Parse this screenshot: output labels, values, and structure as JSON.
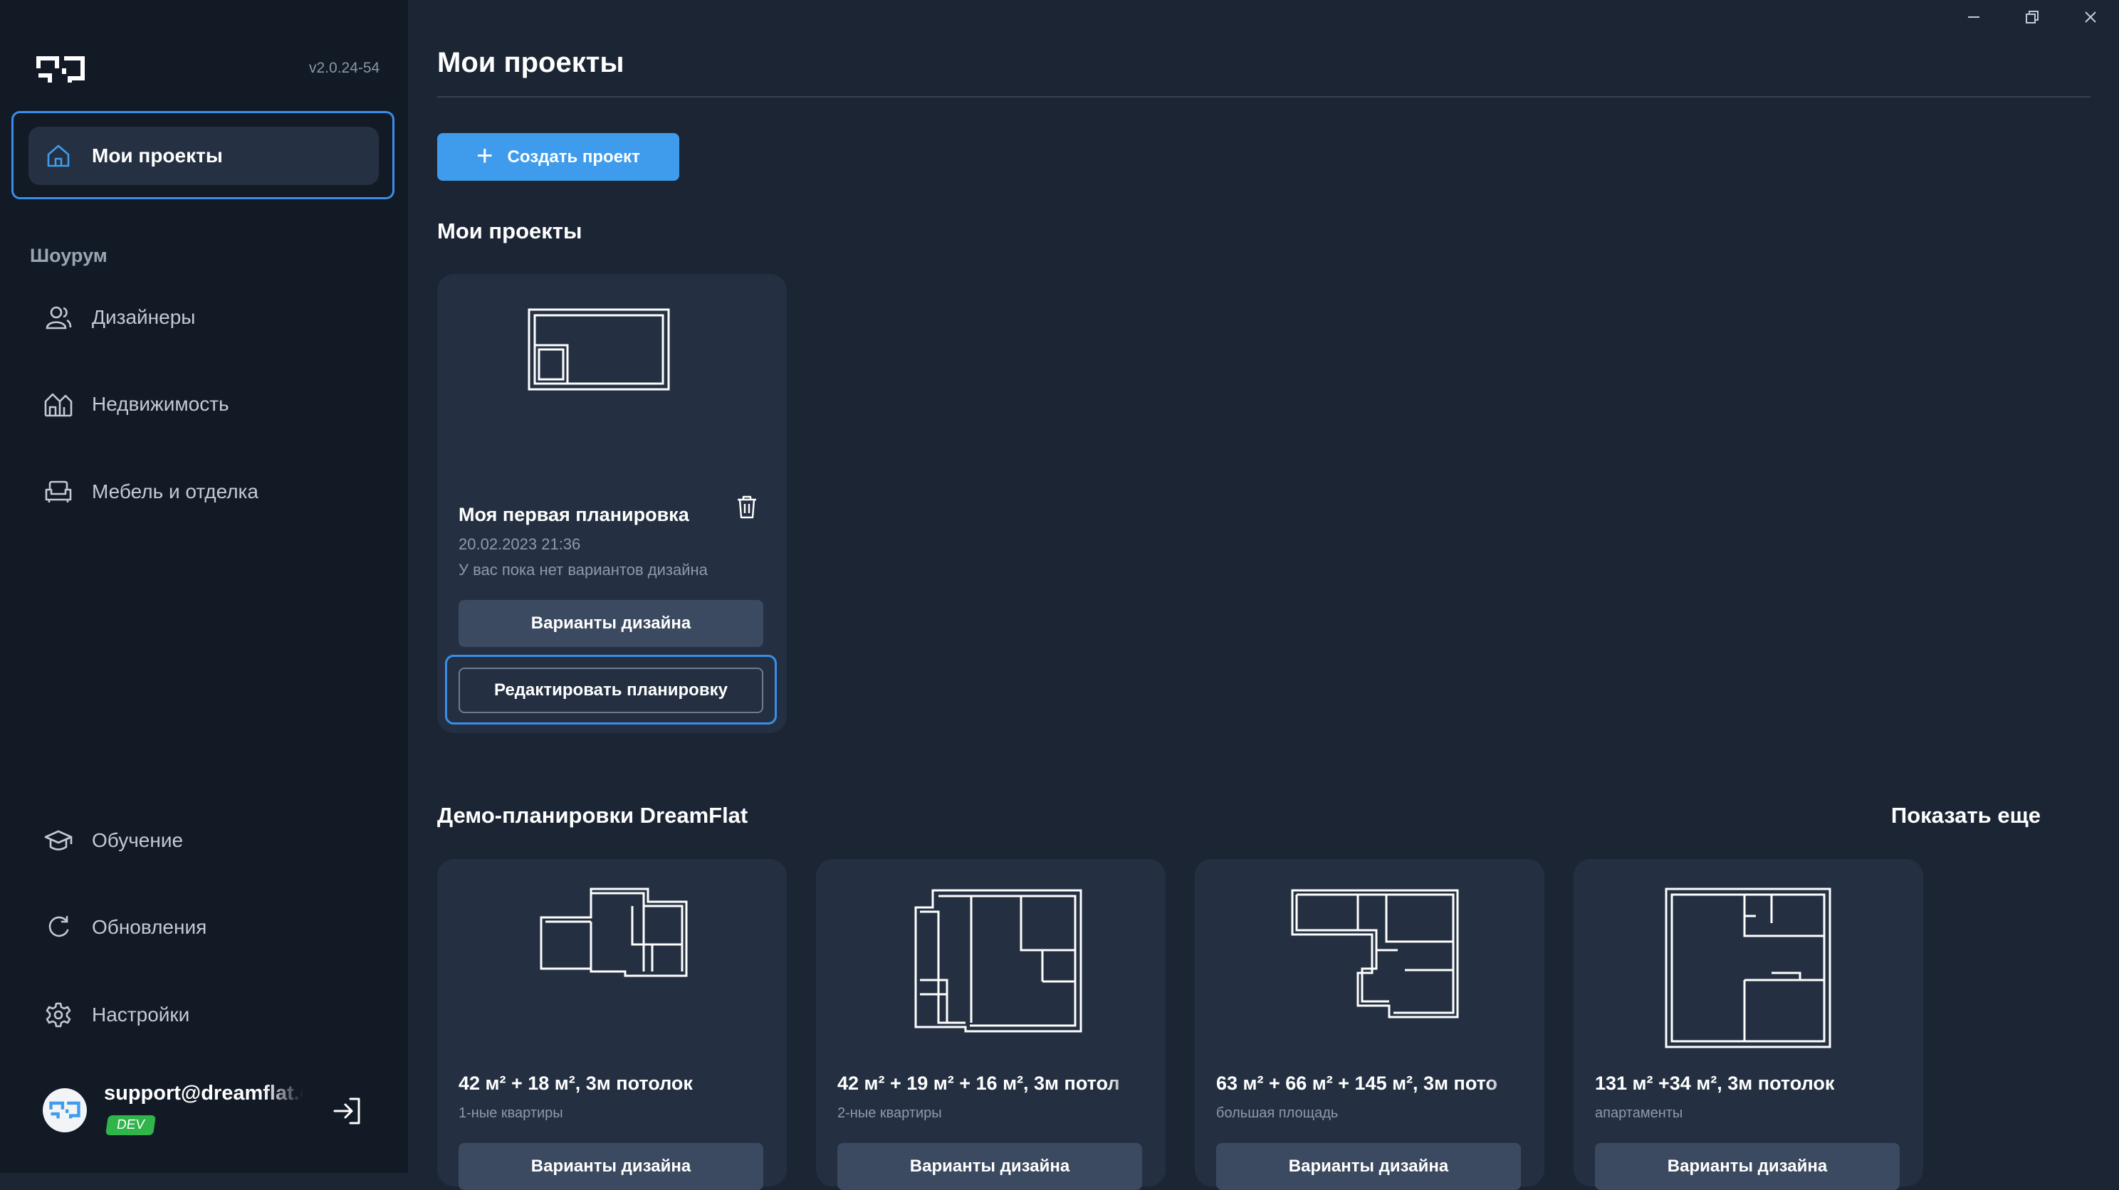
{
  "app": {
    "version": "v2.0.24-54"
  },
  "sidebar": {
    "items_top": [
      {
        "label": "Мои проекты",
        "icon": "home-icon"
      }
    ],
    "section_label": "Шоурум",
    "items_showroom": [
      {
        "label": "Дизайнеры",
        "icon": "users-icon"
      },
      {
        "label": "Недвижимость",
        "icon": "buildings-icon"
      },
      {
        "label": "Мебель и отделка",
        "icon": "sofa-icon"
      }
    ],
    "items_bottom": [
      {
        "label": "Обучение",
        "icon": "graduation-cap-icon"
      },
      {
        "label": "Обновления",
        "icon": "refresh-icon"
      },
      {
        "label": "Настройки",
        "icon": "gear-icon"
      }
    ],
    "user": {
      "email": "support@dreamflat.d",
      "badge": "DEV"
    }
  },
  "main": {
    "page_title": "Мои проекты",
    "create_button": "Создать проект",
    "my_projects_title": "Мои проекты",
    "project": {
      "title": "Моя первая планировка",
      "date": "20.02.2023 21:36",
      "status": "У вас пока нет вариантов дизайна",
      "variants_button": "Варианты дизайна",
      "edit_button": "Редактировать планировку"
    },
    "demo_title": "Демо-планировки DreamFlat",
    "show_more": "Показать еще",
    "demo_cards": [
      {
        "title": "42 м² + 18 м², 3м потолок",
        "meta": "1-ные квартиры",
        "button": "Варианты дизайна"
      },
      {
        "title": "42 м² + 19 м² + 16 м², 3м потол",
        "meta": "2-ные квартиры",
        "button": "Варианты дизайна"
      },
      {
        "title": "63 м² + 66 м² + 145 м², 3м пото",
        "meta": "большая площадь",
        "button": "Варианты дизайна"
      },
      {
        "title": "131 м² +34 м², 3м потолок",
        "meta": "апартаменты",
        "button": "Варианты дизайна"
      }
    ]
  },
  "colors": {
    "background": "#1c2534",
    "sidebar": "#121a26",
    "card": "#243042",
    "accent": "#3f9cec",
    "focus": "#3a8ee8",
    "dev_badge": "#2fb54a"
  }
}
